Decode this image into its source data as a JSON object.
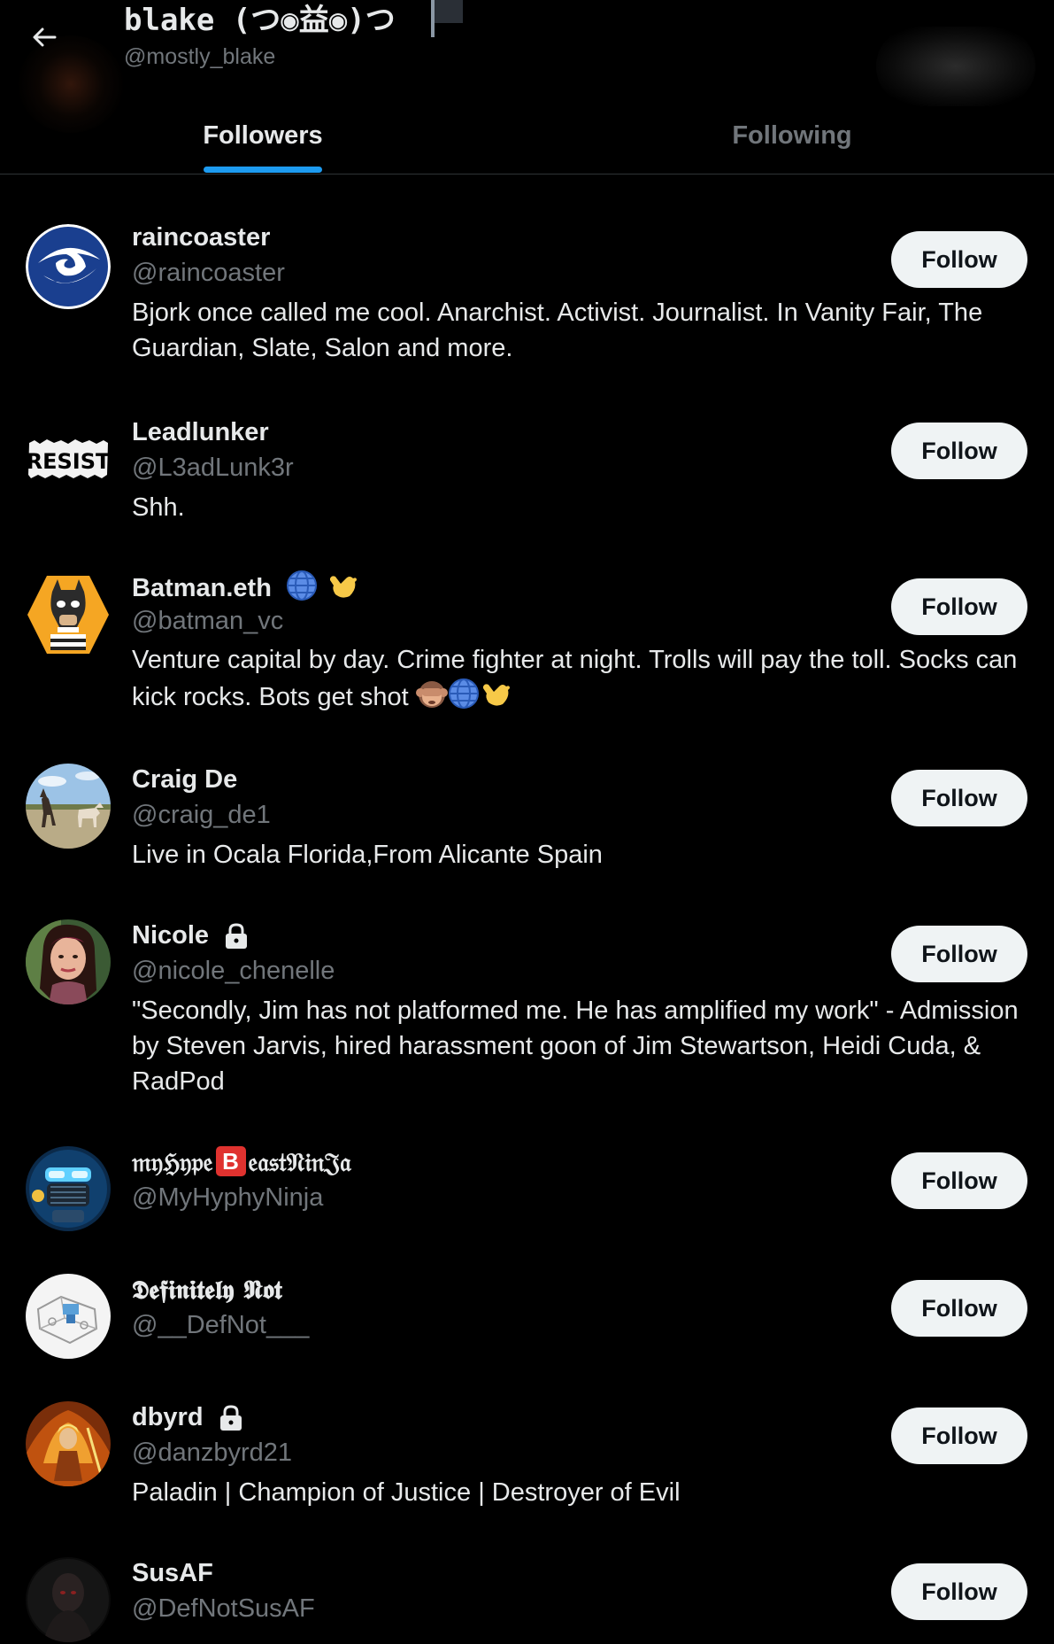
{
  "header": {
    "profile_name": "blake (つ◉益◉)つ",
    "profile_handle": "@mostly_blake",
    "flag_icon": "black-flag-icon",
    "back_icon": "back-arrow-icon"
  },
  "tabs": [
    {
      "label": "Followers",
      "active": true
    },
    {
      "label": "Following",
      "active": false
    }
  ],
  "colors": {
    "background": "#000000",
    "accent": "#1d9bf0",
    "text_primary": "#e7e9ea",
    "text_secondary": "#71767b",
    "button_bg": "#eff3f4",
    "button_text": "#0f1419"
  },
  "follow_label": "Follow",
  "users": [
    {
      "name": "raincoaster",
      "handle": "@raincoaster",
      "bio": "Bjork once called me cool. Anarchist. Activist. Journalist. In Vanity Fair, The Guardian, Slate, Salon and more.",
      "avatar_icon": "eye-logo-avatar"
    },
    {
      "name": "Leadlunker",
      "handle": "@L3adLunk3r",
      "bio": "Shh.",
      "avatar_icon": "resist-logo-avatar",
      "avatar_text": "RESIST"
    },
    {
      "name": "Batman.eth",
      "handle": "@batman_vc",
      "bio": "Venture capital by day. Crime fighter at night. Trolls will pay the toll. Socks can kick rocks. Bots get shot",
      "name_emojis": [
        "globe-icon",
        "call-me-hand-icon"
      ],
      "bio_emojis": [
        "see-no-evil-monkey-icon",
        "globe-icon",
        "call-me-hand-icon"
      ],
      "avatar_icon": "batman-ape-avatar"
    },
    {
      "name": "Craig De",
      "handle": "@craig_de1",
      "bio": "Live in Ocala Florida,From Alicante Spain",
      "avatar_icon": "horses-field-avatar"
    },
    {
      "name": "Nicole",
      "handle": "@nicole_chenelle",
      "bio": "\"Secondly, Jim has not platformed me. He has amplified my work\" - Admission by Steven Jarvis, hired harassment goon of Jim Stewartson, Heidi Cuda, & RadPod",
      "protected": true,
      "avatar_icon": "woman-portrait-avatar"
    },
    {
      "name_part1": "𝔪𝔶ℌ𝔶𝔭𝔢",
      "name_badge": "B",
      "name_part2": "𝔢𝔞𝔰𝔱𝔑𝔦𝔫𝔍𝔞",
      "handle": "@MyHyphyNinja",
      "avatar_icon": "robot-mask-avatar"
    },
    {
      "name": "𝕯𝖊𝖋𝖎𝖓𝖎𝖙𝖊𝖑𝖞 𝕹𝖔𝖙",
      "handle": "@__DefNot___",
      "avatar_icon": "sketch-drawing-avatar"
    },
    {
      "name": "dbyrd",
      "handle": "@danzbyrd21",
      "bio": "Paladin | Champion of Justice | Destroyer of Evil",
      "protected": true,
      "avatar_icon": "paladin-fire-avatar"
    },
    {
      "name": "SusAF",
      "handle": "@DefNotSusAF",
      "avatar_icon": "dark-figure-avatar"
    }
  ]
}
